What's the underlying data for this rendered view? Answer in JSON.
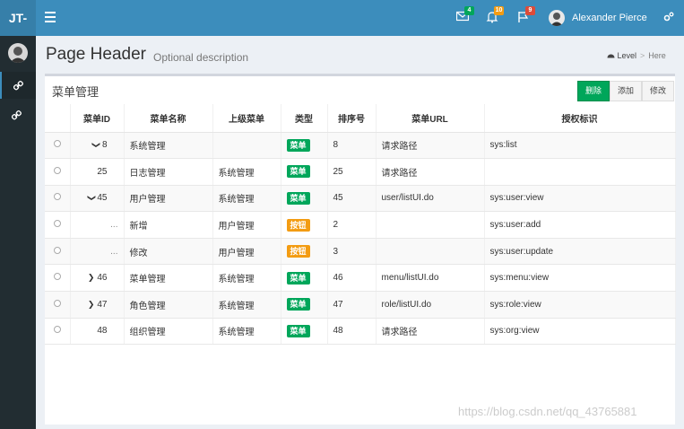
{
  "app": {
    "logo": "JT-",
    "user_name": "Alexander Pierce",
    "badges": {
      "mail": "4",
      "bell": "10",
      "flag": "9"
    },
    "colors": {
      "primary": "#3c8dbc",
      "success": "#00a65a",
      "warning": "#f39c12",
      "danger_badge": "#dd4b39"
    }
  },
  "header": {
    "title": "Page Header",
    "description": "Optional description",
    "breadcrumb": {
      "level": "Level",
      "here": "Here"
    }
  },
  "box": {
    "title": "菜单管理",
    "buttons": {
      "delete": "删除",
      "add": "添加",
      "edit": "修改"
    }
  },
  "table": {
    "columns": [
      "菜单ID",
      "菜单名称",
      "上级菜单",
      "类型",
      "排序号",
      "菜单URL",
      "授权标识"
    ],
    "rows": [
      {
        "chevron": "down",
        "id": "8",
        "name": "系统管理",
        "parent": "",
        "type": "菜单",
        "type_kind": "menu",
        "sort": "8",
        "url": "请求路径",
        "perm": "sys:list"
      },
      {
        "chevron": "",
        "id": "25",
        "name": "日志管理",
        "parent": "系统管理",
        "type": "菜单",
        "type_kind": "menu",
        "sort": "25",
        "url": "请求路径",
        "perm": ""
      },
      {
        "chevron": "down",
        "id": "45",
        "name": "用户管理",
        "parent": "系统管理",
        "type": "菜单",
        "type_kind": "menu",
        "sort": "45",
        "url": "user/listUI.do",
        "perm": "sys:user:view"
      },
      {
        "chevron": "",
        "id": "...",
        "name": "新增",
        "parent": "用户管理",
        "type": "按钮",
        "type_kind": "button",
        "sort": "2",
        "url": "",
        "perm": "sys:user:add"
      },
      {
        "chevron": "",
        "id": "...",
        "name": "修改",
        "parent": "用户管理",
        "type": "按钮",
        "type_kind": "button",
        "sort": "3",
        "url": "",
        "perm": "sys:user:update"
      },
      {
        "chevron": "right",
        "id": "46",
        "name": "菜单管理",
        "parent": "系统管理",
        "type": "菜单",
        "type_kind": "menu",
        "sort": "46",
        "url": "menu/listUI.do",
        "perm": "sys:menu:view"
      },
      {
        "chevron": "right",
        "id": "47",
        "name": "角色管理",
        "parent": "系统管理",
        "type": "菜单",
        "type_kind": "menu",
        "sort": "47",
        "url": "role/listUI.do",
        "perm": "sys:role:view"
      },
      {
        "chevron": "",
        "id": "48",
        "name": "组织管理",
        "parent": "系统管理",
        "type": "菜单",
        "type_kind": "menu",
        "sort": "48",
        "url": "请求路径",
        "perm": "sys:org:view"
      }
    ]
  },
  "watermark": "https://blog.csdn.net/qq_43765881"
}
